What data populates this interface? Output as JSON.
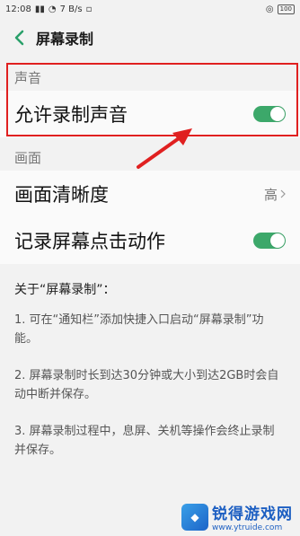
{
  "status_bar": {
    "time": "12:08",
    "network_speed": "7 B/s",
    "battery": "100"
  },
  "header": {
    "title": "屏幕录制"
  },
  "sections": {
    "sound": {
      "label": "声音",
      "allow_record_audio": {
        "label": "允许录制声音",
        "enabled": true
      }
    },
    "picture": {
      "label": "画面",
      "clarity": {
        "label": "画面清晰度",
        "value": "高"
      },
      "record_taps": {
        "label": "记录屏幕点击动作",
        "enabled": true
      }
    }
  },
  "info": {
    "title": "关于“屏幕录制”：",
    "items": [
      "1. 可在“通知栏”添加快捷入口启动“屏幕录制”功能。",
      "2. 屏幕录制时长到达30分钟或大小到达2GB时会自动中断并保存。",
      "3. 屏幕录制过程中，息屏、关机等操作会终止录制并保存。"
    ]
  },
  "watermark": {
    "name": "锐得游戏网",
    "url": "www.ytruide.com"
  },
  "colors": {
    "toggle_on": "#3ca86a",
    "highlight": "#e02020",
    "back_arrow": "#2aa06a"
  }
}
